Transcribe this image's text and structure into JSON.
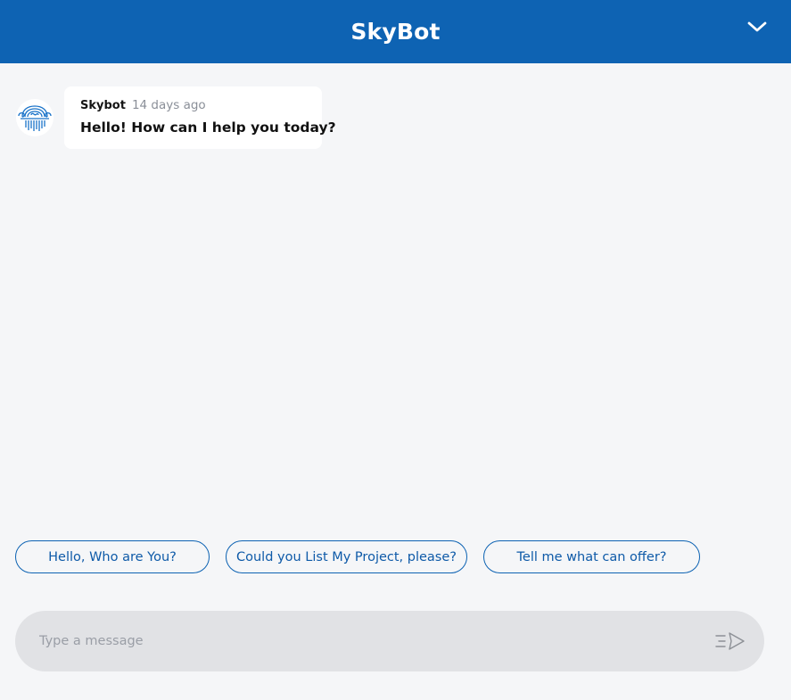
{
  "header": {
    "title": "SkyBot",
    "collapse_icon": "chevron-down-icon"
  },
  "messages": [
    {
      "sender": "Skybot",
      "time": "14 days ago",
      "text": "Hello! How can I help you today?",
      "avatar_icon": "skybot-logo-icon"
    }
  ],
  "suggestions": [
    {
      "label": "Hello, Who are You?"
    },
    {
      "label": "Could you List My Project, please?"
    },
    {
      "label": "Tell me what can offer?"
    }
  ],
  "composer": {
    "placeholder": "Type a message",
    "value": "",
    "send_icon": "send-icon"
  },
  "colors": {
    "brand": "#0e63b3",
    "background": "#f5f6f8",
    "input_bg": "#e1e2e5"
  }
}
